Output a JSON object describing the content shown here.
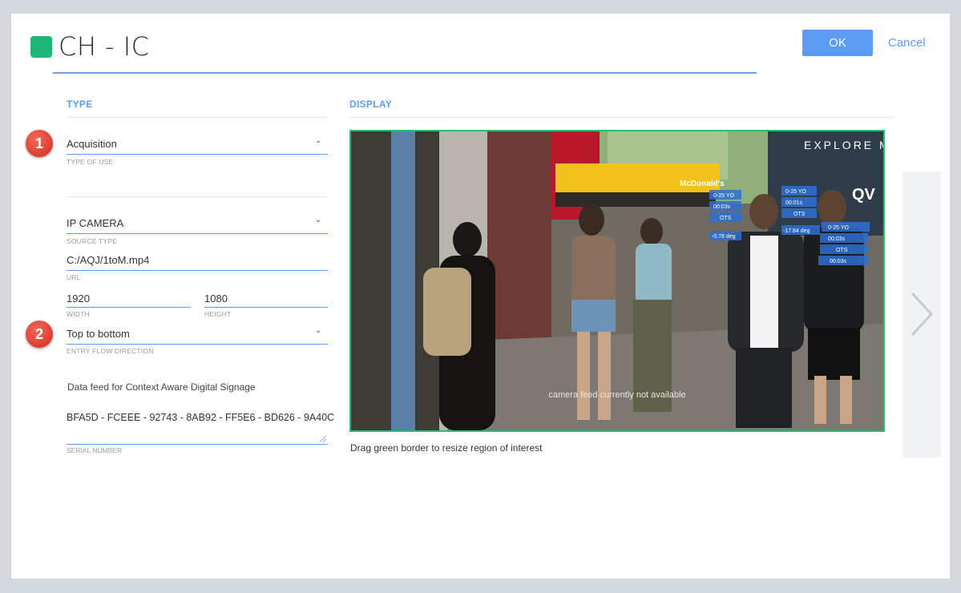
{
  "header": {
    "title": "CH - IC",
    "accent_color": "#1db877",
    "ok_label": "OK",
    "cancel_label": "Cancel"
  },
  "type_section": {
    "heading": "TYPE",
    "badge_1": "1",
    "badge_2": "2",
    "type_of_use": {
      "value": "Acquisition",
      "caption": "TYPE OF USE"
    },
    "source_type": {
      "value": "IP CAMERA",
      "caption": "SOURCE TYPE"
    },
    "url": {
      "value": "C:/AQJ/1toM.mp4",
      "caption": "URL"
    },
    "width": {
      "value": "1920",
      "caption": "WIDTH"
    },
    "height": {
      "value": "1080",
      "caption": "HEIGHT"
    },
    "entry_flow": {
      "value": "Top to bottom",
      "caption": "ENTRY FLOW DIRECTION"
    },
    "data_feed_label": "Data feed for Context Aware Digital Signage",
    "serial": {
      "value": "BFA5D - FCEEE - 92743 - 8AB92 - FF5E6 - BD626 - 9A40C",
      "caption": "SERIAL NUMBER"
    }
  },
  "display_section": {
    "heading": "DISPLAY",
    "video_overlay_text": "camera feed currently not available",
    "sign_text": "EXPLORE MORE",
    "store_sign_text": "McDonald's",
    "qv_text": "QV",
    "tag_age": "0-25 YO",
    "tag_time": "00:03s",
    "tag_ots": "OTS",
    "tag_deg_1": "-0.78 deg",
    "tag_deg_2": "-17.84 deg",
    "tag_time_2": "00:01s",
    "drag_hint": "Drag green border to resize region of interest",
    "border_color": "#2dbd6e"
  },
  "side_panel": {
    "icon": "chevron-right-icon"
  }
}
